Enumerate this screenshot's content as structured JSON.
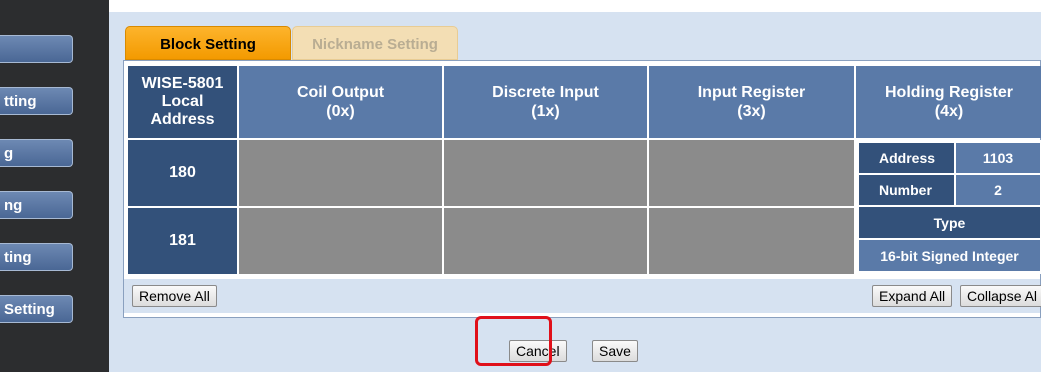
{
  "sidebar": {
    "items": [
      {
        "label": ""
      },
      {
        "label": "tting"
      },
      {
        "label": "g"
      },
      {
        "label": "ng"
      },
      {
        "label": "ting"
      },
      {
        "label": "Setting"
      }
    ]
  },
  "tabs": {
    "active": "Block Setting",
    "inactive": "Nickname Setting"
  },
  "table": {
    "headers": {
      "address": "WISE-5801 Local Address",
      "coil": "Coil Output (0x)",
      "discrete": "Discrete Input (1x)",
      "input_register": "Input Register (3x)",
      "holding_register": "Holding Register (4x)"
    },
    "rows": [
      {
        "address": "180"
      },
      {
        "address": "181"
      }
    ],
    "holding_block": {
      "address_label": "Address",
      "address_value": "1103",
      "number_label": "Number",
      "number_value": "2",
      "type_label": "Type",
      "type_value": "16-bit Signed Integer"
    }
  },
  "toolbar": {
    "remove_all": "Remove All",
    "expand_all": "Expand All",
    "collapse_all": "Collapse Al"
  },
  "footer": {
    "cancel": "Cancel",
    "save": "Save"
  },
  "colors": {
    "accent_tab": "#f39a00",
    "header_blue": "#5a7aa8",
    "dark_blue": "#33517a",
    "highlight": "#e0101a"
  }
}
